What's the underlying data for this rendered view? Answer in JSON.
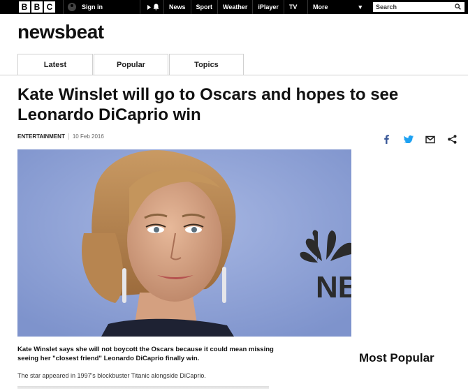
{
  "topbar": {
    "logo_letters": [
      "B",
      "B",
      "C"
    ],
    "signin_label": "Sign in",
    "nav": [
      "News",
      "Sport",
      "Weather",
      "iPlayer",
      "TV"
    ],
    "more_label": "More",
    "search_placeholder": "Search"
  },
  "brand": "newsbeat",
  "tabs": [
    "Latest",
    "Popular",
    "Topics"
  ],
  "article": {
    "headline": "Kate Winslet will go to Oscars and hopes to see Leonardo DiCaprio win",
    "category": "ENTERTAINMENT",
    "date": "10 Feb 2016",
    "hero_logo_text": "NBC",
    "lead": "Kate Winslet says she will not boycott the Oscars because it could mean missing seeing her \"closest friend\" Leonardo DiCaprio finally win.",
    "para1": "The star appeared in 1997's blockbuster Titanic alongside DiCaprio."
  },
  "sidebar": {
    "most_popular_title": "Most Popular"
  },
  "share": [
    "facebook-icon",
    "twitter-icon",
    "email-icon",
    "share-icon"
  ],
  "colors": {
    "topbar_bg": "#000000",
    "facebook": "#3b5998",
    "twitter": "#1da1f2",
    "hero_bg": "#94a5d6"
  }
}
